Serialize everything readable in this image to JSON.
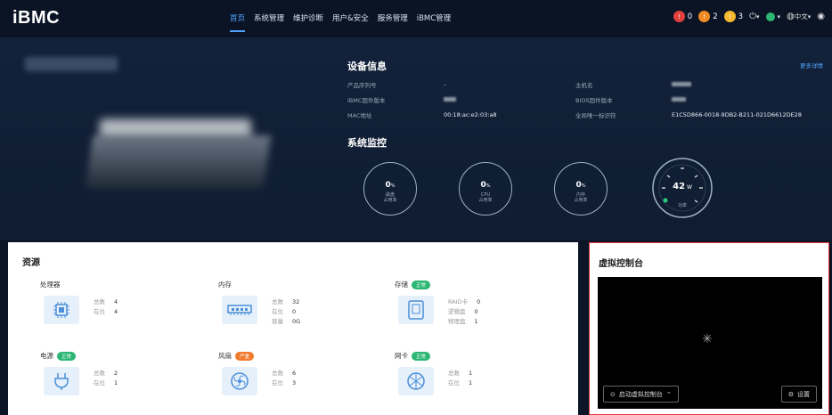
{
  "header": {
    "logo": "iBMC",
    "nav": [
      "首页",
      "系统管理",
      "维护诊断",
      "用户&安全",
      "服务管理",
      "iBMC管理"
    ],
    "alerts": [
      {
        "count": "0",
        "color": "#e2403c"
      },
      {
        "count": "2",
        "color": "#f08a24"
      },
      {
        "count": "3",
        "color": "#f5b82e"
      }
    ],
    "lang": "中文"
  },
  "device": {
    "title": "设备信息",
    "more": "更多详情",
    "rows": [
      {
        "k1": "产品序列号",
        "v1": "-",
        "k2": "主机名",
        "v2": ""
      },
      {
        "k1": "iBMC固件版本",
        "v1": "",
        "k2": "BIOS固件版本",
        "v2": ""
      },
      {
        "k1": "MAC地址",
        "v1": "00:18:ac:e2:03:a8",
        "k2": "全局唯一标识符",
        "v2": "E1C5D866-0018-9DB2-B211-021D6612DE28"
      }
    ]
  },
  "monitor": {
    "title": "系统监控",
    "gauges": [
      {
        "value": "0",
        "unit": "%",
        "label1": "磁盘",
        "label2": "占用率"
      },
      {
        "value": "0",
        "unit": "%",
        "label1": "CPU",
        "label2": "占用率"
      },
      {
        "value": "0",
        "unit": "%",
        "label1": "内存",
        "label2": "占用率"
      }
    ],
    "power": {
      "value": "42",
      "unit": "W",
      "label": "功率"
    }
  },
  "resources": {
    "title": "资源",
    "items": [
      {
        "name": "处理器",
        "badge": "",
        "stats": [
          [
            "总数",
            "4"
          ],
          [
            "在位",
            "4"
          ]
        ]
      },
      {
        "name": "内存",
        "badge": "",
        "stats": [
          [
            "总数",
            "32"
          ],
          [
            "在位",
            "0"
          ],
          [
            "容量",
            "0G"
          ]
        ]
      },
      {
        "name": "存储",
        "badge": "正常",
        "badge_color": "#2bb673",
        "stats": [
          [
            "RAID卡",
            "0"
          ],
          [
            "逻辑盘",
            "0"
          ],
          [
            "物理盘",
            "1"
          ]
        ]
      },
      {
        "name": "电源",
        "badge": "正常",
        "badge_color": "#2bb673",
        "stats": [
          [
            "总数",
            "2"
          ],
          [
            "在位",
            "1"
          ]
        ]
      },
      {
        "name": "风扇",
        "badge": "严重",
        "badge_color": "#f0792b",
        "stats": [
          [
            "总数",
            "6"
          ],
          [
            "在位",
            "3"
          ]
        ]
      },
      {
        "name": "网卡",
        "badge": "正常",
        "badge_color": "#2bb673",
        "stats": [
          [
            "总数",
            "1"
          ],
          [
            "在位",
            "1"
          ]
        ]
      }
    ]
  },
  "console": {
    "title": "虚拟控制台",
    "launch": "启动虚拟控制台",
    "settings": "设置"
  }
}
